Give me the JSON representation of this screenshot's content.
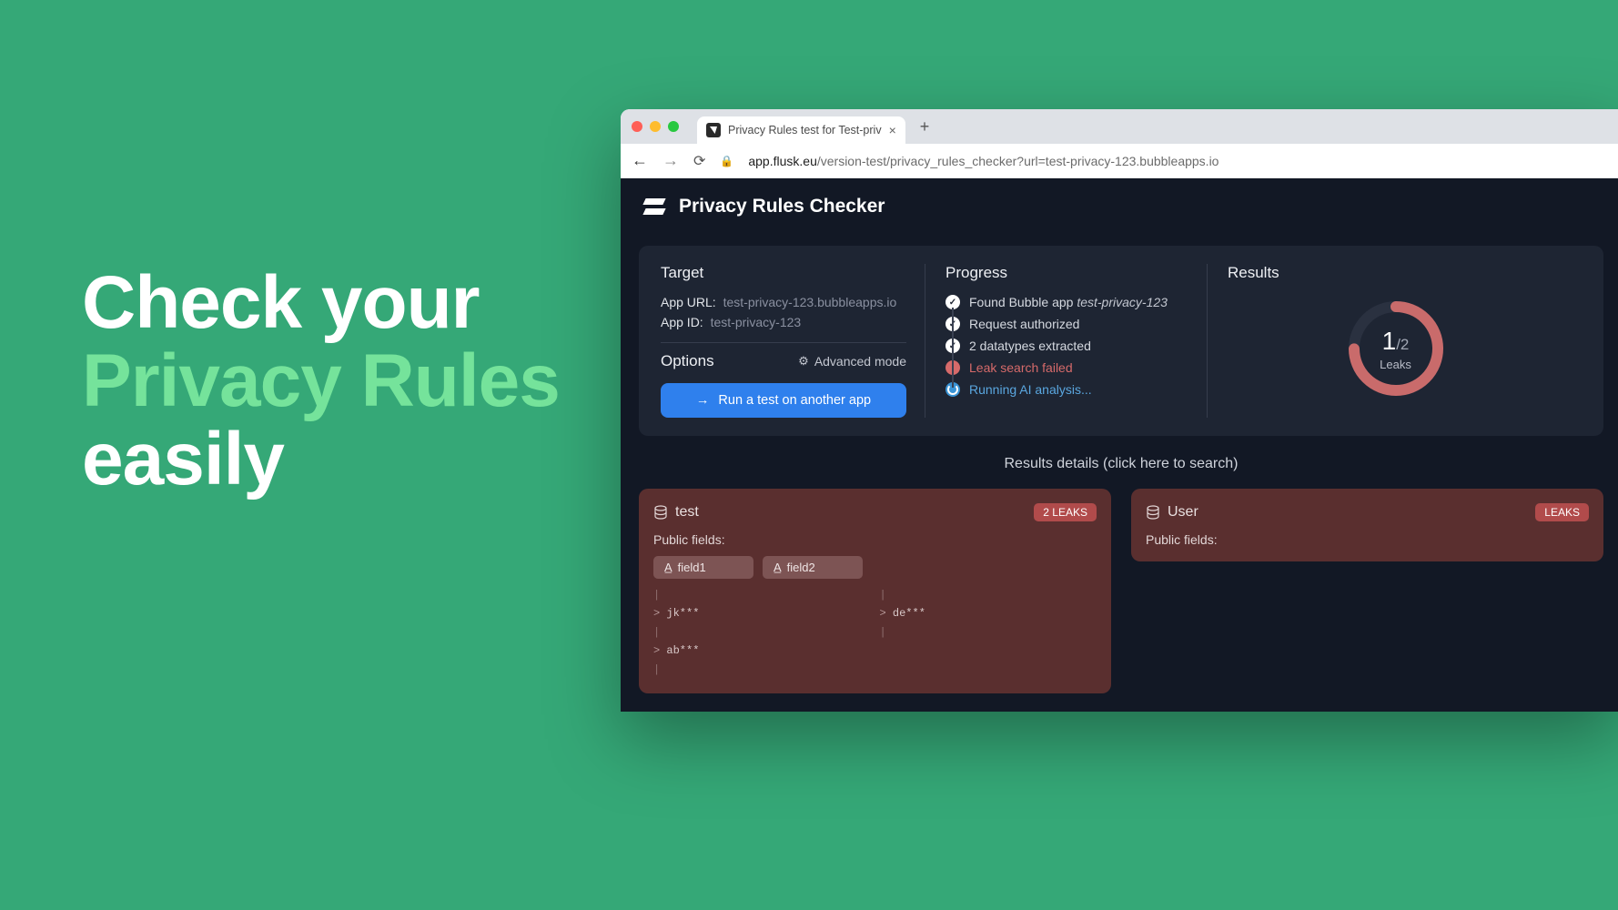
{
  "hero": {
    "line1": "Check your",
    "line2": "Privacy Rules",
    "line3": "easily"
  },
  "browser": {
    "tab_title": "Privacy Rules test for Test-priv",
    "url_domain": "app.flusk.eu",
    "url_path": "/version-test/privacy_rules_checker?url=test-privacy-123.bubbleapps.io"
  },
  "app": {
    "title": "Privacy Rules Checker",
    "target": {
      "heading": "Target",
      "url_label": "App URL:",
      "url_value": "test-privacy-123.bubbleapps.io",
      "id_label": "App ID:",
      "id_value": "test-privacy-123",
      "options_heading": "Options",
      "advanced_label": "Advanced mode",
      "run_button": "Run a test on another app"
    },
    "progress": {
      "heading": "Progress",
      "items": [
        {
          "status": "ok",
          "text": "Found Bubble app ",
          "em": "test-privacy-123"
        },
        {
          "status": "ok",
          "text": "Request authorized"
        },
        {
          "status": "ok",
          "text": "2 datatypes extracted"
        },
        {
          "status": "fail",
          "text": "Leak search failed"
        },
        {
          "status": "loading",
          "text": "Running AI analysis..."
        }
      ]
    },
    "results": {
      "heading": "Results",
      "found": 1,
      "total": 2,
      "label": "Leaks"
    },
    "details_heading": "Results details (click here to search)",
    "cards": [
      {
        "name": "test",
        "badge": "2 LEAKS",
        "public_fields_label": "Public fields:",
        "fields": [
          "field1",
          "field2"
        ],
        "leaks": [
          [
            "jk***",
            "ab***"
          ],
          [
            "de***"
          ]
        ]
      },
      {
        "name": "User",
        "badge": "LEAKS",
        "public_fields_label": "Public fields:"
      }
    ]
  }
}
